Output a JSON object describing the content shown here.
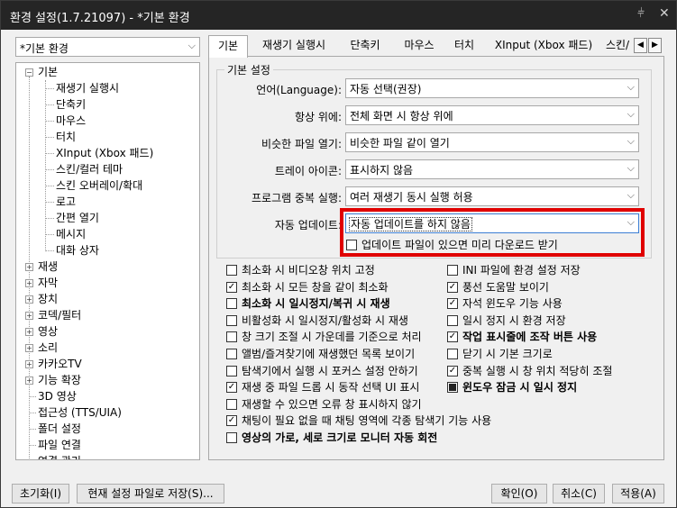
{
  "window": {
    "title": "환경 설정(1.7.21097) - *기본 환경",
    "pin_icon": "pin-icon",
    "close_icon": "close-icon"
  },
  "profile_select": {
    "value": "*기본 환경"
  },
  "tree": [
    {
      "label": "기본",
      "expanded": true
    },
    {
      "label": "재생기 실행시"
    },
    {
      "label": "단축키"
    },
    {
      "label": "마우스"
    },
    {
      "label": "터치"
    },
    {
      "label": "XInput (Xbox 패드)"
    },
    {
      "label": "스킨/컬러 테마"
    },
    {
      "label": "스킨 오버레이/확대"
    },
    {
      "label": "로고"
    },
    {
      "label": "간편 열기"
    },
    {
      "label": "메시지"
    },
    {
      "label": "대화 상자"
    },
    {
      "label": "재생"
    },
    {
      "label": "자막"
    },
    {
      "label": "장치"
    },
    {
      "label": "코덱/필터"
    },
    {
      "label": "영상"
    },
    {
      "label": "소리"
    },
    {
      "label": "카카오TV"
    },
    {
      "label": "기능 확장"
    },
    {
      "label": "3D 영상"
    },
    {
      "label": "접근성 (TTS/UIA)"
    },
    {
      "label": "폴더 설정"
    },
    {
      "label": "파일 연결"
    },
    {
      "label": "연결 관리"
    }
  ],
  "tabs": [
    "기본",
    "재생기 실행시",
    "단축키",
    "마우스",
    "터치",
    "XInput (Xbox 패드)",
    "스킨/"
  ],
  "group_title": "기본 설정",
  "settings": [
    {
      "label": "언어(Language):",
      "value": "자동 선택(권장)"
    },
    {
      "label": "항상 위에:",
      "value": "전체 화면 시 항상 위에"
    },
    {
      "label": "비슷한 파일 열기:",
      "value": "비슷한 파일 같이 열기"
    },
    {
      "label": "트레이 아이콘:",
      "value": "표시하지 않음"
    },
    {
      "label": "프로그램 중복 실행:",
      "value": "여러 재생기 동시 실행 허용"
    },
    {
      "label": "자동 업데이트:",
      "value": "자동 업데이트를 하지 않음"
    }
  ],
  "predownload": {
    "label": "업데이트 파일이 있으면 미리 다운로드 받기",
    "checked": false
  },
  "checks_left": [
    {
      "label": "최소화 시 비디오창 위치 고정",
      "checked": false
    },
    {
      "label": "최소화 시 모든 창을 같이 최소화",
      "checked": true
    },
    {
      "label": "최소화 시 일시정지/복귀 시 재생",
      "checked": false,
      "bold": true
    },
    {
      "label": "비활성화 시 일시정지/활성화 시 재생",
      "checked": false
    },
    {
      "label": "창 크기 조절 시 가운데를 기준으로 처리",
      "checked": false
    },
    {
      "label": "앨범/즐겨찾기에 재생했던 목록 보이기",
      "checked": false
    },
    {
      "label": "탐색기에서 실행 시 포커스 설정 안하기",
      "checked": false
    },
    {
      "label": "재생 중 파일 드롭 시 동작 선택 UI 표시",
      "checked": true
    },
    {
      "label": "재생할 수 있으면 오류 창 표시하지 않기",
      "checked": false
    },
    {
      "label": "채팅이 필요 없을 때 채팅 영역에 각종 탐색기 기능 사용",
      "checked": true
    },
    {
      "label": "영상의 가로, 세로 크기로 모니터 자동 회전",
      "checked": false,
      "bold": true
    }
  ],
  "checks_right": [
    {
      "label": "INI 파일에 환경 설정 저장",
      "checked": false
    },
    {
      "label": "풍선 도움말 보이기",
      "checked": true
    },
    {
      "label": "자석 윈도우 기능 사용",
      "checked": true
    },
    {
      "label": "일시 정지 시 환경 저장",
      "checked": false
    },
    {
      "label": "작업 표시줄에 조작 버튼 사용",
      "checked": true,
      "bold": true
    },
    {
      "label": "닫기 시 기본 크기로",
      "checked": false
    },
    {
      "label": "중복 실행 시 창 위치 적당히 조절",
      "checked": true
    },
    {
      "label": "윈도우 잠금 시 일시 정지",
      "checked": "partial",
      "bold": true
    }
  ],
  "buttons": {
    "reset": "초기화(I)",
    "save_current": "현재 설정 파일로 저장(S)...",
    "ok": "확인(O)",
    "cancel": "취소(C)",
    "apply": "적용(A)"
  },
  "colors": {
    "titlebar": "#252525",
    "highlight": "#e00000",
    "focus": "#3c7fd4"
  }
}
